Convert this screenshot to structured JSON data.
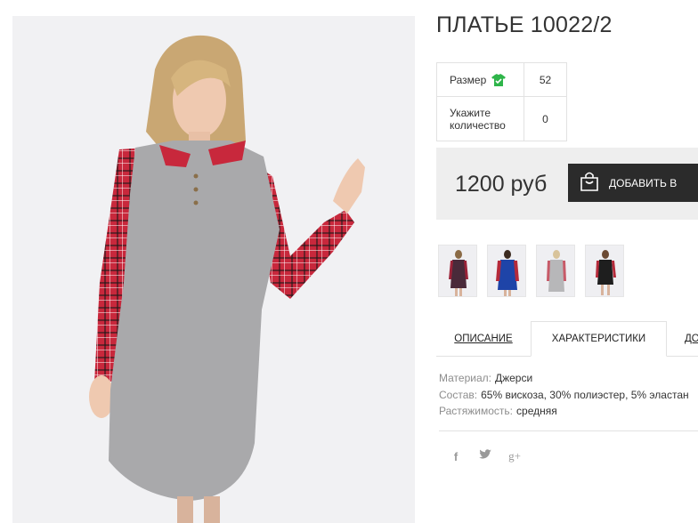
{
  "product": {
    "title": "ПЛАТЬЕ 10022/2"
  },
  "options": {
    "size_label": "Размер",
    "size_value": "52",
    "quantity_label": "Укажите количество",
    "quantity_value": "0",
    "size_icon": "tshirt-check-icon",
    "size_icon_color": "#2fb54a"
  },
  "purchase": {
    "price": "1200 руб",
    "add_button_label": "ДОБАВИТЬ В",
    "button_icon": "shopping-bag-icon"
  },
  "thumbnails": [
    {
      "name": "thumb-burgundy-plaid"
    },
    {
      "name": "thumb-blue-red"
    },
    {
      "name": "thumb-grey-red"
    },
    {
      "name": "thumb-black-red"
    }
  ],
  "tabs": {
    "description": "ОПИСАНИЕ",
    "characteristics": "ХАРАКТЕРИСТИКИ",
    "more": "ДО"
  },
  "specs": [
    {
      "key": "Материал:",
      "value": "Джерси"
    },
    {
      "key": "Состав:",
      "value": "65% вискоза, 30% полиэстер, 5% эластан"
    },
    {
      "key": "Растяжимость:",
      "value": "средняя"
    }
  ],
  "social": {
    "facebook": "f",
    "twitter": "🐦",
    "google_plus": "g+"
  },
  "colors": {
    "button_bg": "#2b2b2b",
    "price_bar_bg": "#eeeeee",
    "accent_green": "#2fb54a"
  }
}
